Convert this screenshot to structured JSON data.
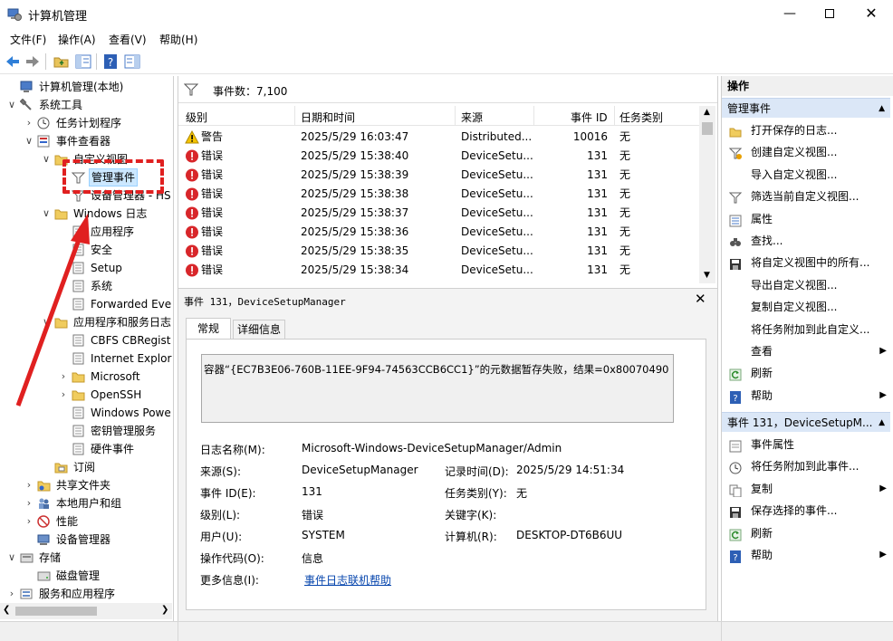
{
  "window": {
    "title": "计算机管理"
  },
  "menu": [
    "文件(F)",
    "操作(A)",
    "查看(V)",
    "帮助(H)"
  ],
  "tree": [
    {
      "label": "计算机管理(本地)",
      "icon": "computer-icon"
    },
    {
      "label": "系统工具",
      "icon": "tools-icon"
    },
    {
      "label": "任务计划程序",
      "icon": "clock-icon"
    },
    {
      "label": "事件查看器",
      "icon": "event-viewer-icon"
    },
    {
      "label": "自定义视图",
      "icon": "folder-icon"
    },
    {
      "label": "管理事件",
      "icon": "filter-icon"
    },
    {
      "label": "设备管理器 - HS",
      "icon": "filter-icon"
    },
    {
      "label": "Windows 日志",
      "icon": "folder-icon"
    },
    {
      "label": "应用程序",
      "icon": "log-icon"
    },
    {
      "label": "安全",
      "icon": "log-icon"
    },
    {
      "label": "Setup",
      "icon": "log-icon"
    },
    {
      "label": "系统",
      "icon": "log-icon"
    },
    {
      "label": "Forwarded Eve",
      "icon": "log-icon"
    },
    {
      "label": "应用程序和服务日志",
      "icon": "folder-icon"
    },
    {
      "label": "CBFS CBRegist",
      "icon": "log-icon"
    },
    {
      "label": "Internet Explor",
      "icon": "log-icon"
    },
    {
      "label": "Microsoft",
      "icon": "folder-icon"
    },
    {
      "label": "OpenSSH",
      "icon": "folder-icon"
    },
    {
      "label": "Windows Powe",
      "icon": "log-icon"
    },
    {
      "label": "密钥管理服务",
      "icon": "log-icon"
    },
    {
      "label": "硬件事件",
      "icon": "log-icon"
    },
    {
      "label": "订阅",
      "icon": "subscription-icon"
    },
    {
      "label": "共享文件夹",
      "icon": "shared-folder-icon"
    },
    {
      "label": "本地用户和组",
      "icon": "users-icon"
    },
    {
      "label": "性能",
      "icon": "performance-icon"
    },
    {
      "label": "设备管理器",
      "icon": "device-manager-icon"
    },
    {
      "label": "存储",
      "icon": "storage-icon"
    },
    {
      "label": "磁盘管理",
      "icon": "disk-icon"
    },
    {
      "label": "服务和应用程序",
      "icon": "services-icon"
    }
  ],
  "events": {
    "count_label": "事件数：7,100",
    "columns": [
      "级别",
      "日期和时间",
      "来源",
      "事件 ID",
      "任务类别"
    ],
    "rows": [
      [
        "警告",
        "2025/5/29 16:03:47",
        "Distributed...",
        "10016",
        "无"
      ],
      [
        "错误",
        "2025/5/29 15:38:40",
        "DeviceSetu...",
        "131",
        "无"
      ],
      [
        "错误",
        "2025/5/29 15:38:39",
        "DeviceSetu...",
        "131",
        "无"
      ],
      [
        "错误",
        "2025/5/29 15:38:38",
        "DeviceSetu...",
        "131",
        "无"
      ],
      [
        "错误",
        "2025/5/29 15:38:37",
        "DeviceSetu...",
        "131",
        "无"
      ],
      [
        "错误",
        "2025/5/29 15:38:36",
        "DeviceSetu...",
        "131",
        "无"
      ],
      [
        "错误",
        "2025/5/29 15:38:35",
        "DeviceSetu...",
        "131",
        "无"
      ],
      [
        "错误",
        "2025/5/29 15:38:34",
        "DeviceSetu...",
        "131",
        "无"
      ]
    ]
  },
  "detail": {
    "header": "事件 131，DeviceSetupManager",
    "tabs": [
      "常规",
      "详细信息"
    ],
    "message": "容器“{EC7B3E06-760B-11EE-9F94-74563CCB6CC1}”的元数据暂存失败，结果=0x80070490",
    "fields": {
      "log_name_label": "日志名称(M):",
      "log_name": "Microsoft-Windows-DeviceSetupManager/Admin",
      "source_label": "来源(S):",
      "source": "DeviceSetupManager",
      "logged_label": "记录时间(D):",
      "logged": "2025/5/29 14:51:34",
      "event_id_label": "事件 ID(E):",
      "event_id": "131",
      "task_label": "任务类别(Y):",
      "task": "无",
      "level_label": "级别(L):",
      "level": "错误",
      "keywords_label": "关键字(K):",
      "keywords": "",
      "user_label": "用户(U):",
      "user": "SYSTEM",
      "computer_label": "计算机(R):",
      "computer": "DESKTOP-DT6B6UU",
      "opcode_label": "操作代码(O):",
      "opcode": "信息",
      "more_label": "更多信息(I):",
      "more_link": "事件日志联机帮助"
    }
  },
  "actions": {
    "title": "操作",
    "section1": "管理事件",
    "items1": [
      {
        "label": "打开保存的日志...",
        "icon": "open-folder-icon"
      },
      {
        "label": "创建自定义视图...",
        "icon": "filter-add-icon"
      },
      {
        "label": "导入自定义视图...",
        "icon": "blank-icon"
      },
      {
        "label": "筛选当前自定义视图...",
        "icon": "filter-icon"
      },
      {
        "label": "属性",
        "icon": "properties-icon"
      },
      {
        "label": "查找...",
        "icon": "find-icon"
      },
      {
        "label": "将自定义视图中的所有...",
        "icon": "save-icon"
      },
      {
        "label": "导出自定义视图...",
        "icon": "blank-icon"
      },
      {
        "label": "复制自定义视图...",
        "icon": "blank-icon"
      },
      {
        "label": "将任务附加到此自定义...",
        "icon": "blank-icon"
      },
      {
        "label": "查看",
        "icon": "blank-icon",
        "arrow": true
      },
      {
        "label": "刷新",
        "icon": "refresh-icon"
      },
      {
        "label": "帮助",
        "icon": "help-icon",
        "arrow": true
      }
    ],
    "section2": "事件 131，DeviceSetupM...",
    "items2": [
      {
        "label": "事件属性",
        "icon": "event-properties-icon"
      },
      {
        "label": "将任务附加到此事件...",
        "icon": "attach-task-icon"
      },
      {
        "label": "复制",
        "icon": "copy-icon",
        "arrow": true
      },
      {
        "label": "保存选择的事件...",
        "icon": "save-icon"
      },
      {
        "label": "刷新",
        "icon": "refresh-icon"
      },
      {
        "label": "帮助",
        "icon": "help-icon",
        "arrow": true
      }
    ]
  },
  "colors": {
    "accent": "#1f5fbf",
    "selection": "#cce8ff",
    "annotation": "#e02020",
    "warning": "#f5c400",
    "error": "#d8262a"
  }
}
